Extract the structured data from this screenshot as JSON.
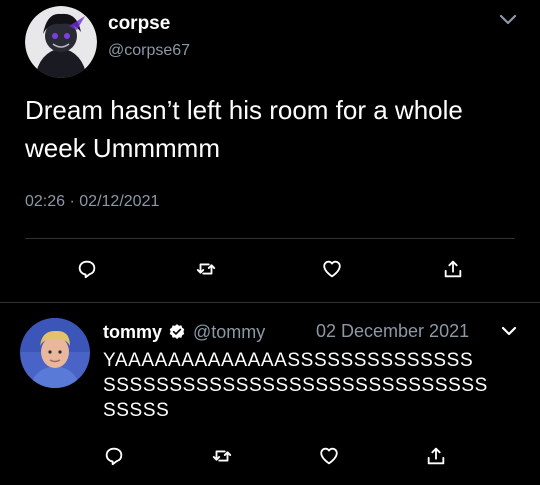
{
  "main_tweet": {
    "author_name": "corpse",
    "author_handle": "@corpse67",
    "text": "Dream hasn’t left his room for a whole week Ummmmm",
    "time": "02:26",
    "separator": "·",
    "date": "02/12/2021"
  },
  "actions": {
    "reply_icon": "reply-icon",
    "retweet_icon": "retweet-icon",
    "like_icon": "heart-icon",
    "share_icon": "share-icon"
  },
  "reply": {
    "author_name": "tommy",
    "verified": true,
    "author_handle": "@tommy",
    "date": "02 December 2021",
    "text_lines": [
      "YAAAAAAAAAAAAASSSSSSSSSSSSSS",
      "SSSSSSSSSSSSSSSSSSSSSSSSSSSSS",
      "SSSSS"
    ]
  },
  "colors": {
    "background": "#000000",
    "text": "#ffffff",
    "secondary_text": "#8b98a5",
    "divider": "#2f3336",
    "verified_badge": "#ffffff"
  }
}
